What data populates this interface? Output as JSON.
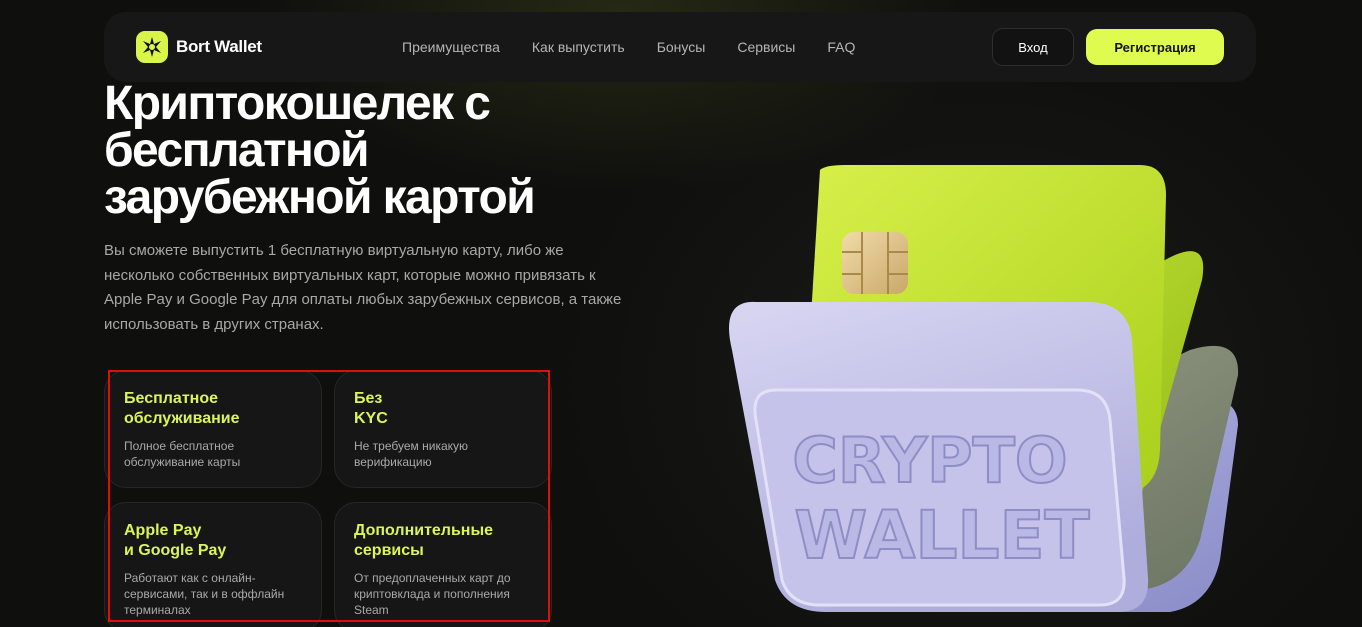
{
  "header": {
    "brand": "Bort Wallet",
    "logo_icon": "star-burst-icon",
    "nav": [
      "Преимущества",
      "Как выпустить",
      "Бонусы",
      "Сервисы",
      "FAQ"
    ],
    "login_label": "Вход",
    "register_label": "Регистрация"
  },
  "hero": {
    "title": "Криптокошелек с бесплатной зарубежной картой",
    "description": "Вы сможете выпустить 1 бесплатную виртуальную карту, либо же несколько собственных виртуальных карт, которые можно привязать к Apple Pay и Google Pay для оплаты любых зарубежных сервисов, а также использовать в других странах."
  },
  "features": [
    {
      "title": "Бесплатное\nобслуживание",
      "text": "Полное бесплатное\nобслуживание карты"
    },
    {
      "title": "Без\nKYC",
      "text": "Не требуем никакую\nверификацию"
    },
    {
      "title": "Apple Pay\nи Google Pay",
      "text": "Работают как с онлайн-\nсервисами, так и в оффлайн\nтерминалах"
    },
    {
      "title": "Дополнительные\nсервисы",
      "text": "От предоплаченных карт до\nкриптовклада и пополнения\nSteam"
    }
  ],
  "illustration": {
    "line1": "CRYPTO",
    "line2": "WALLET"
  },
  "colors": {
    "accent": "#e0fb4f",
    "feature_title": "#dcf45a",
    "highlight_box": "#e00d0d"
  }
}
